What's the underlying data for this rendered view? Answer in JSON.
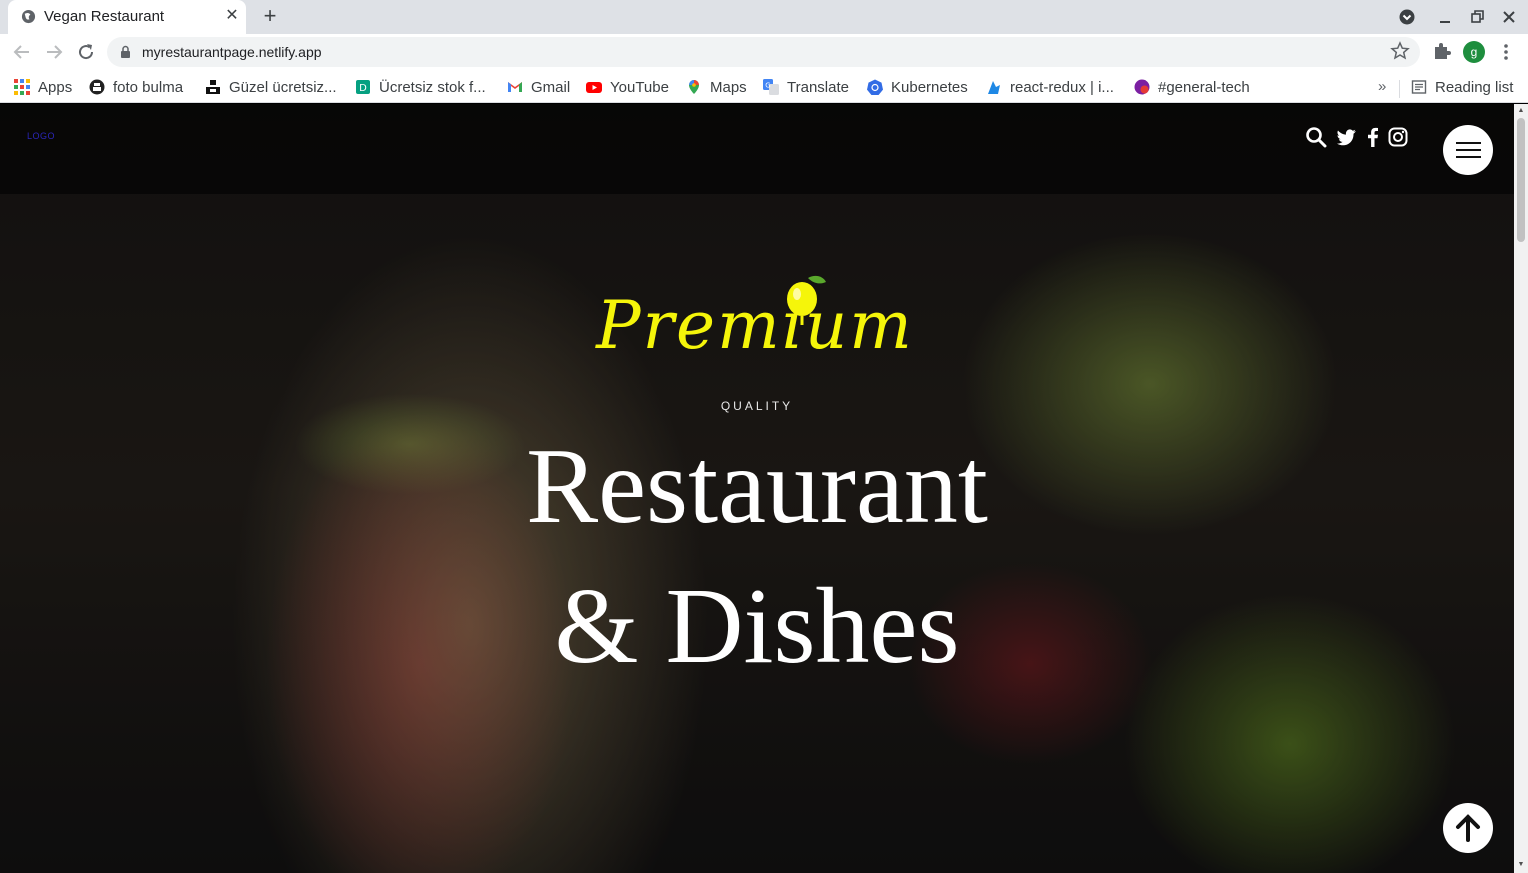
{
  "browser": {
    "tab_title": "Vegan Restaurant",
    "tab_close": "✕",
    "new_tab": "+",
    "url": "myrestaurantpage.netlify.app",
    "profile_initial": "g",
    "bookmarks": [
      {
        "label": "Apps",
        "icon": "apps-icon"
      },
      {
        "label": "foto bulma",
        "icon": "unsplash-icon"
      },
      {
        "label": "Güzel ücretsiz...",
        "icon": "unsplash-black-icon"
      },
      {
        "label": "Ücretsiz stok f...",
        "icon": "stock-photo-icon"
      },
      {
        "label": "Gmail",
        "icon": "gmail-icon"
      },
      {
        "label": "YouTube",
        "icon": "youtube-icon"
      },
      {
        "label": "Maps",
        "icon": "maps-icon"
      },
      {
        "label": "Translate",
        "icon": "translate-icon"
      },
      {
        "label": "Kubernetes",
        "icon": "kubernetes-icon"
      },
      {
        "label": "react-redux | i...",
        "icon": "react-redux-icon"
      },
      {
        "label": "#general-tech",
        "icon": "slack-icon"
      }
    ],
    "bookmarks_more": "»",
    "reading_list": "Reading list"
  },
  "page": {
    "logo": "LOGO",
    "premium": "Premium",
    "quality": "QUALITY",
    "headline_line1": "Restaurant",
    "headline_line2": "& Dishes",
    "social_icons": [
      "search-icon",
      "twitter-icon",
      "facebook-icon",
      "instagram-icon"
    ]
  },
  "colors": {
    "premium_yellow": "#f5f50a",
    "logo_blue": "#2b26b8",
    "tab_strip": "#dee1e6"
  }
}
